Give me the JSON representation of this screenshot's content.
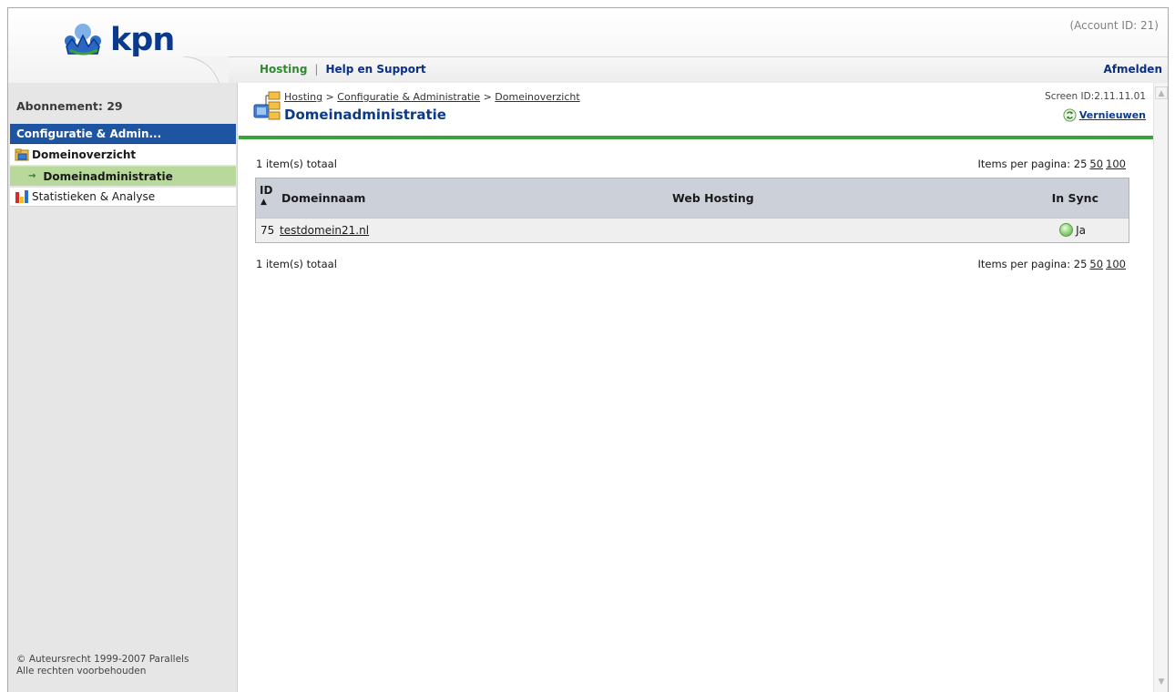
{
  "header": {
    "logo_text": "kpn",
    "account_id": "(Account ID: 21)",
    "nav": {
      "hosting": "Hosting",
      "separator": "|",
      "help": "Help en Support",
      "logout": "Afmelden"
    }
  },
  "sidebar": {
    "subscription": "Abonnement: 29",
    "section": "Configuratie & Admin...",
    "items": [
      {
        "label": "Domeinoverzicht",
        "icon": "domain-icon"
      },
      {
        "label": "Domeinadministratie",
        "icon": "arrow-right-icon"
      },
      {
        "label": "Statistieken & Analyse",
        "icon": "bar-chart-icon"
      }
    ],
    "copyright_line1": "© Auteursrecht 1999-2007 Parallels",
    "copyright_line2": "Alle rechten voorbehouden"
  },
  "main": {
    "breadcrumb": {
      "hosting": "Hosting",
      "sep": " > ",
      "config": "Configuratie & Administratie",
      "overview": "Domeinoverzicht"
    },
    "title": "Domeinadministratie",
    "screen_id": "Screen ID:2.11.11.01",
    "refresh": "Vernieuwen",
    "count_total": "1 item(s) totaal",
    "items_per_page_label": "Items per pagina:",
    "page_sizes": [
      "25",
      "50",
      "100"
    ],
    "table": {
      "columns": [
        "ID",
        "Domeinnaam",
        "Web Hosting",
        "In Sync"
      ],
      "sort_indicator": "▲",
      "rows": [
        {
          "id": "75",
          "domain": "testdomein21.nl",
          "web_hosting": "",
          "in_sync": "Ja"
        }
      ]
    }
  },
  "colors": {
    "brand_blue": "#0b3a8c",
    "nav_green": "#2f8a2f",
    "section_blue": "#1e55a3",
    "active_green": "#b8d99b",
    "rule_green": "#3aa23a"
  }
}
